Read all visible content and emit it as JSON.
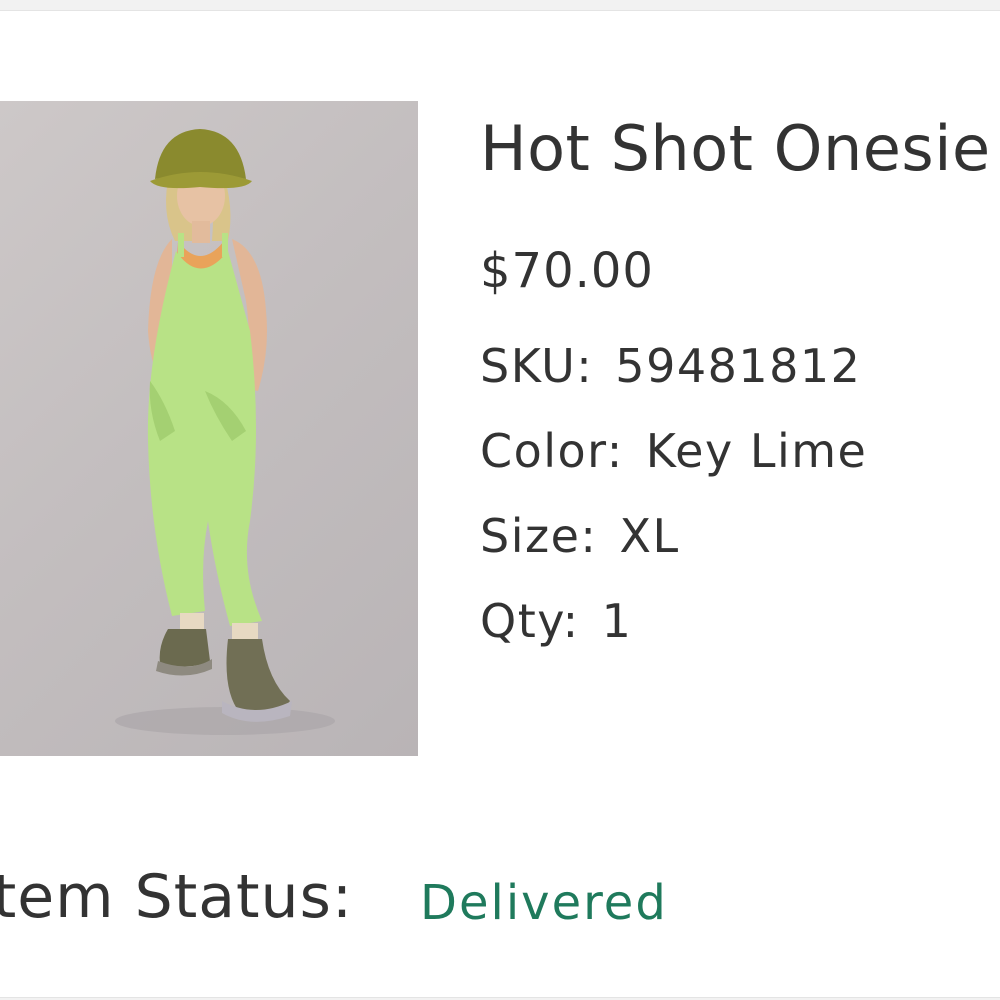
{
  "product": {
    "title": "Hot Shot Onesie",
    "price": "$70.00",
    "image_alt": "Model wearing Key Lime onesie with bucket hat and hiking boots",
    "details": [
      {
        "label": "SKU:",
        "value": "59481812"
      },
      {
        "label": "Color:",
        "value": "Key Lime"
      },
      {
        "label": "Size:",
        "value": "XL"
      },
      {
        "label": "Qty:",
        "value": "1"
      }
    ]
  },
  "status": {
    "label": "Item Status:",
    "value": "Delivered",
    "color": "#1f7a5c"
  }
}
